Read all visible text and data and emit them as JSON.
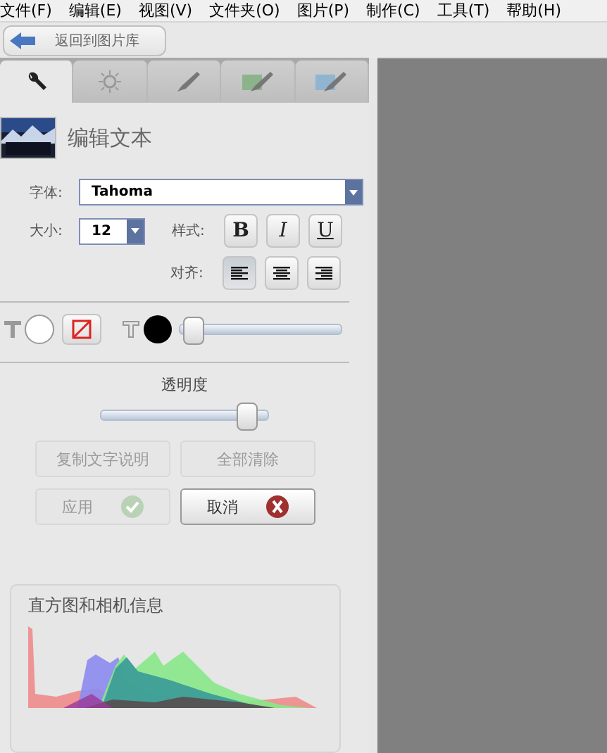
{
  "menu": [
    "文件(F)",
    "编辑(E)",
    "视图(V)",
    "文件夹(O)",
    "图片(P)",
    "制作(C)",
    "工具(T)",
    "帮助(H)"
  ],
  "back_button": "返回到图片库",
  "tabs": [
    {
      "kind": "wrench",
      "selected": true
    },
    {
      "kind": "sun",
      "selected": false
    },
    {
      "kind": "brush",
      "selected": false
    },
    {
      "kind": "green-brush",
      "selected": false
    },
    {
      "kind": "blue-brush",
      "selected": false
    }
  ],
  "panel_title": "编辑文本",
  "font": {
    "label": "字体:",
    "value": "Tahoma"
  },
  "size": {
    "label": "大小:",
    "value": "12"
  },
  "style": {
    "label": "样式:",
    "buttons": [
      {
        "kind": "bold",
        "text": "B",
        "selected": false
      },
      {
        "kind": "italic",
        "text": "I",
        "selected": false
      },
      {
        "kind": "underline",
        "text": "U",
        "selected": false
      }
    ]
  },
  "align": {
    "label": "对齐:",
    "buttons": [
      {
        "kind": "left",
        "selected": true
      },
      {
        "kind": "center",
        "selected": false
      },
      {
        "kind": "right",
        "selected": false
      }
    ]
  },
  "text_opacity_slider": {
    "level": 0.02
  },
  "transparency": {
    "label": "透明度",
    "level": 0.93
  },
  "actions": [
    {
      "kind": "plain",
      "label": "复制文字说明",
      "disabled": true
    },
    {
      "kind": "plain",
      "label": "全部清除",
      "disabled": true
    },
    {
      "kind": "ok",
      "label": "应用",
      "disabled": true
    },
    {
      "kind": "cancel",
      "label": "取消",
      "disabled": false
    }
  ],
  "histogram": {
    "title": "直方图和相机信息"
  }
}
